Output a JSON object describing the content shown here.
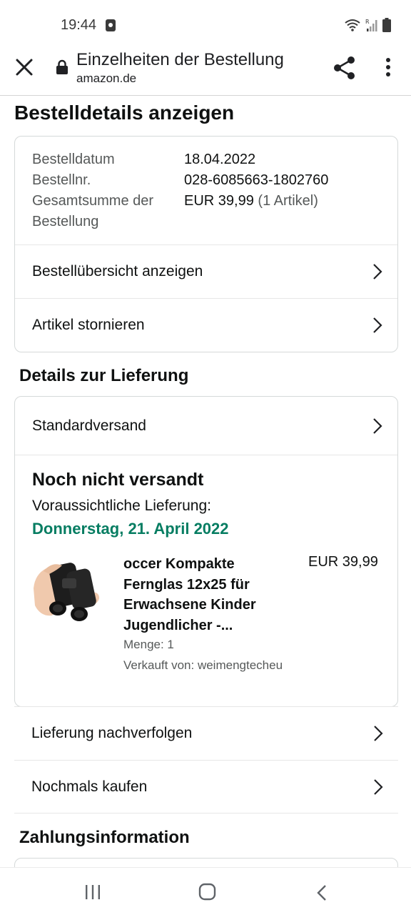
{
  "status_bar": {
    "time": "19:44",
    "icons": [
      "media-icon",
      "wifi-icon",
      "signal-icon",
      "battery-icon"
    ]
  },
  "browser": {
    "page_title": "Einzelheiten der Bestellung",
    "url": "amazon.de",
    "icons": [
      "close-icon",
      "lock-icon",
      "share-icon",
      "more-vert-icon"
    ]
  },
  "page": {
    "title": "Bestelldetails anzeigen"
  },
  "order": {
    "date_label": "Bestelldatum",
    "date_value": "18.04.2022",
    "number_label": "Bestellnr.",
    "number_value": "028-6085663-1802760",
    "total_label_1": "Gesamtsumme der",
    "total_label_2": "Bestellung",
    "total_value": "EUR 39,99",
    "total_items": "(1 Artikel)",
    "view_summary": "Bestellübersicht anzeigen",
    "cancel_items": "Artikel stornieren"
  },
  "delivery": {
    "section_title": "Details zur Lieferung",
    "shipping_method": "Standardversand",
    "status": "Noch nicht versandt",
    "expected_label": "Voraussichtliche Lieferung:",
    "expected_date": "Donnerstag, 21. April 2022",
    "product": {
      "name": "occer Kompakte Fernglas 12x25 für Erwachsene Kinder Jugendlicher -...",
      "price": "EUR 39,99",
      "quantity": "Menge: 1",
      "seller": "Verkauft von: weimengtecheu"
    },
    "track": "Lieferung nachverfolgen",
    "buy_again": "Nochmals kaufen"
  },
  "payment": {
    "section_title": "Zahlungsinformation"
  },
  "colors": {
    "delivery_green": "#067d62",
    "muted_text": "#565959",
    "border": "#d5d9d9"
  }
}
